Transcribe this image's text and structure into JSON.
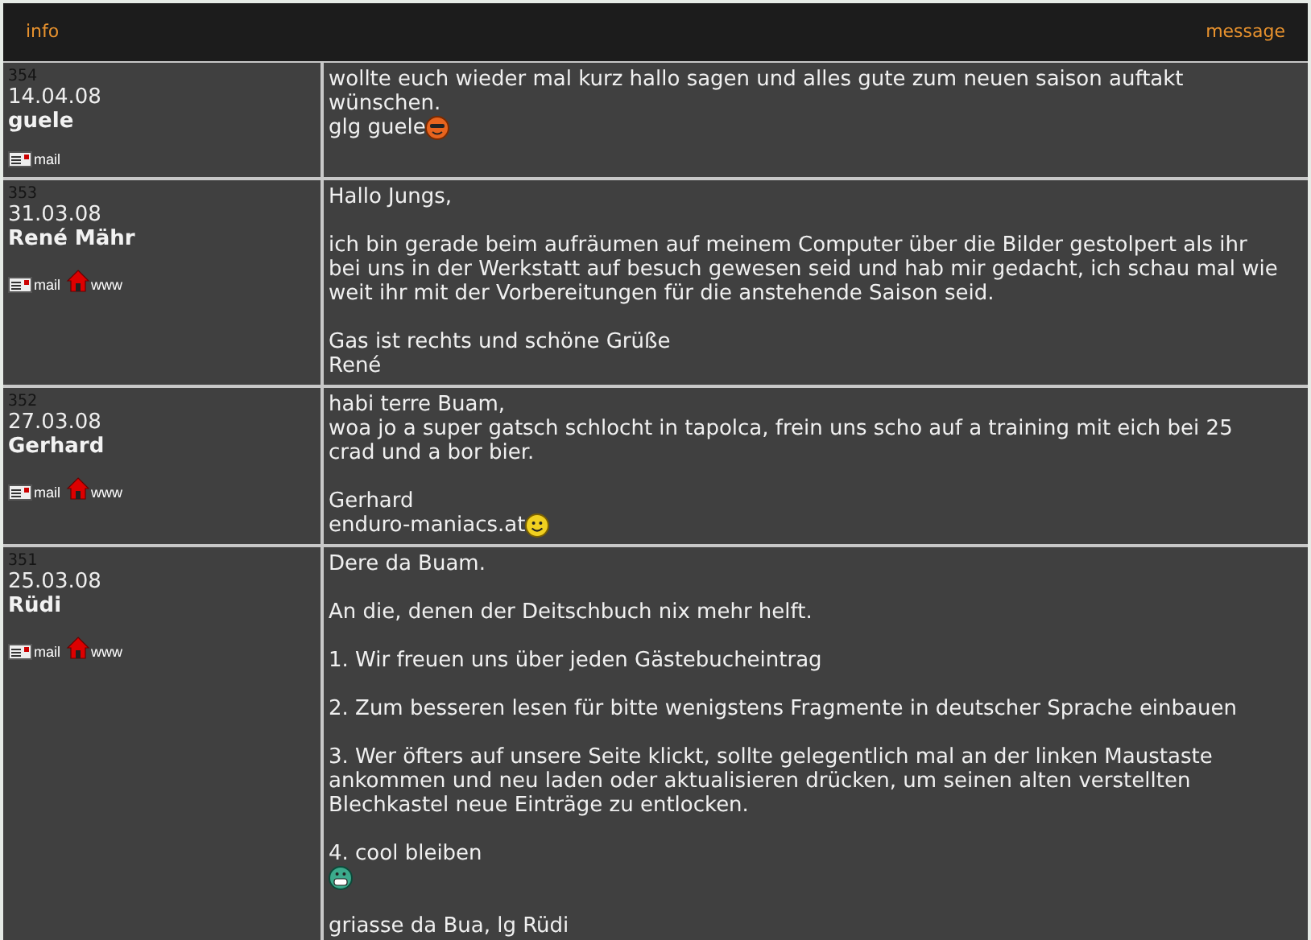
{
  "header": {
    "left": "info",
    "right": "message"
  },
  "entries": [
    {
      "number": "354",
      "date": "14.04.08",
      "author": "guele",
      "links": [
        {
          "kind": "mail",
          "label": "mail"
        }
      ],
      "paragraphs": [
        [
          {
            "text": "wollte euch wieder mal kurz hallo sagen und alles gute zum neuen saison auftakt wünschen."
          },
          {
            "text": "glg guele",
            "smiley": {
              "kind": "cool"
            }
          }
        ]
      ]
    },
    {
      "number": "353",
      "date": "31.03.08",
      "author": "René Mähr",
      "links": [
        {
          "kind": "mail",
          "label": "mail"
        },
        {
          "kind": "www",
          "label": "www"
        }
      ],
      "paragraphs": [
        [
          {
            "text": "Hallo Jungs,"
          }
        ],
        [
          {
            "text": "ich bin gerade beim aufräumen auf meinem Computer über die Bilder gestolpert als ihr bei uns in der Werkstatt auf besuch gewesen seid und hab mir gedacht, ich schau mal wie weit ihr mit der Vorbereitungen für die anstehende Saison seid."
          }
        ],
        [
          {
            "text": "Gas ist rechts und schöne Grüße"
          },
          {
            "text": "René"
          }
        ]
      ]
    },
    {
      "number": "352",
      "date": "27.03.08",
      "author": "Gerhard",
      "links": [
        {
          "kind": "mail",
          "label": "mail"
        },
        {
          "kind": "www",
          "label": "www"
        }
      ],
      "paragraphs": [
        [
          {
            "text": "habi terre Buam,"
          },
          {
            "text": "woa jo a super gatsch schlocht in tapolca, frein uns scho auf a training mit eich bei 25 crad und a bor bier."
          }
        ],
        [
          {
            "text": "Gerhard"
          },
          {
            "text": "enduro-maniacs.at",
            "smiley": {
              "kind": "smile"
            }
          }
        ]
      ]
    },
    {
      "number": "351",
      "date": "25.03.08",
      "author": "Rüdi",
      "links": [
        {
          "kind": "mail",
          "label": "mail"
        },
        {
          "kind": "www",
          "label": "www"
        }
      ],
      "paragraphs": [
        [
          {
            "text": "Dere da Buam."
          }
        ],
        [
          {
            "text": "An die, denen der Deitschbuch nix mehr helft."
          }
        ],
        [
          {
            "text": "1. Wir freuen uns über jeden Gästebucheintrag"
          }
        ],
        [
          {
            "text": "2. Zum besseren lesen für bitte wenigstens Fragmente in deutscher Sprache einbauen"
          }
        ],
        [
          {
            "text": "3. Wer öfters auf unsere Seite klickt, sollte gelegentlich mal an der linken Maustaste ankommen und neu laden oder aktualisieren drücken, um seinen alten verstellten Blechkastel neue Einträge zu entlocken."
          }
        ],
        [
          {
            "text": "4. cool bleiben"
          },
          {
            "smiley": {
              "kind": "grin"
            }
          }
        ],
        [
          {
            "text": "griasse da Bua, lg Rüdi"
          }
        ]
      ]
    }
  ]
}
